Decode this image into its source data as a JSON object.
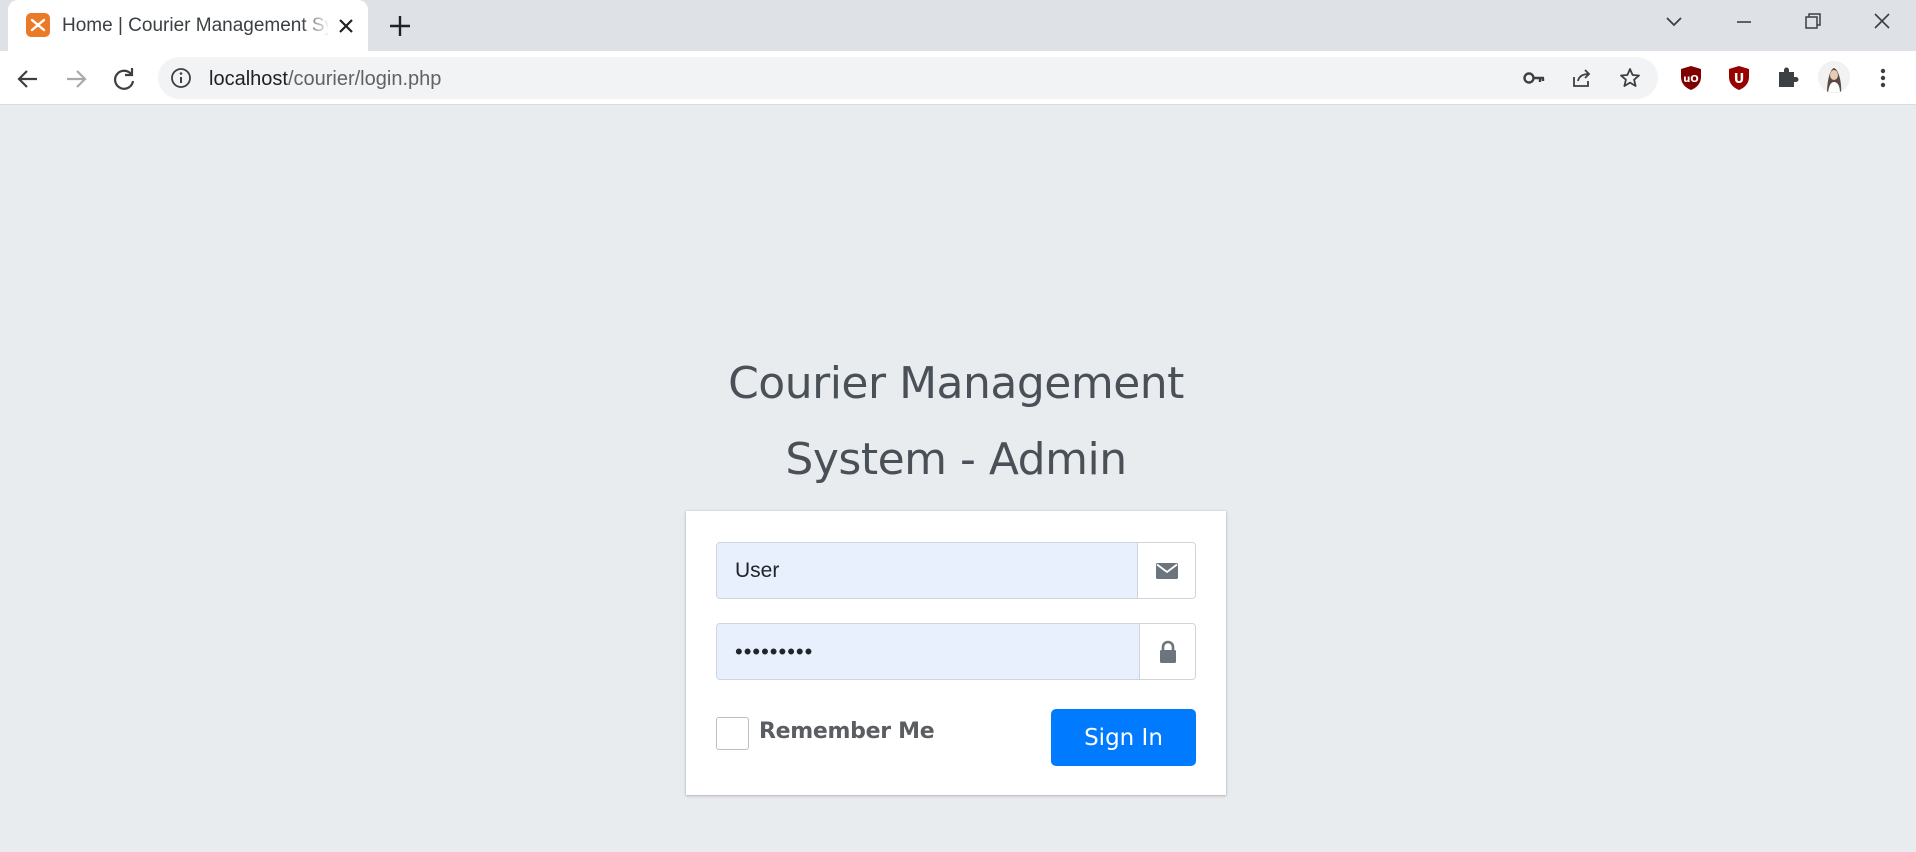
{
  "browser": {
    "tab": {
      "title": "Home | Courier Management System",
      "favicon": "xampp-icon"
    },
    "url": {
      "host": "localhost",
      "path": "/courier/login.php"
    },
    "toolbar_icons": [
      "back-arrow-icon",
      "forward-arrow-icon",
      "reload-icon",
      "site-info-icon",
      "key-icon",
      "share-icon",
      "star-icon"
    ],
    "extensions": [
      "ublock-origin-icon",
      "ublock-red-icon",
      "puzzle-extensions-icon",
      "profile-avatar",
      "kebab-menu-icon"
    ],
    "window_controls": [
      "tab-search-chevron-icon",
      "minimize-icon",
      "restore-icon",
      "close-icon"
    ]
  },
  "login": {
    "title_line1": "Courier Management",
    "title_line2": "System - Admin",
    "username_value": "User",
    "username_icon": "envelope-icon",
    "password_value": "•••••••••",
    "password_icon": "lock-icon",
    "remember_label": "Remember Me",
    "remember_checked": false,
    "signin_label": "Sign In"
  },
  "colors": {
    "page_background": "#e9ecef",
    "primary_button": "#007bff",
    "autofill_background": "#e8f0fe",
    "title_text": "#495057"
  }
}
